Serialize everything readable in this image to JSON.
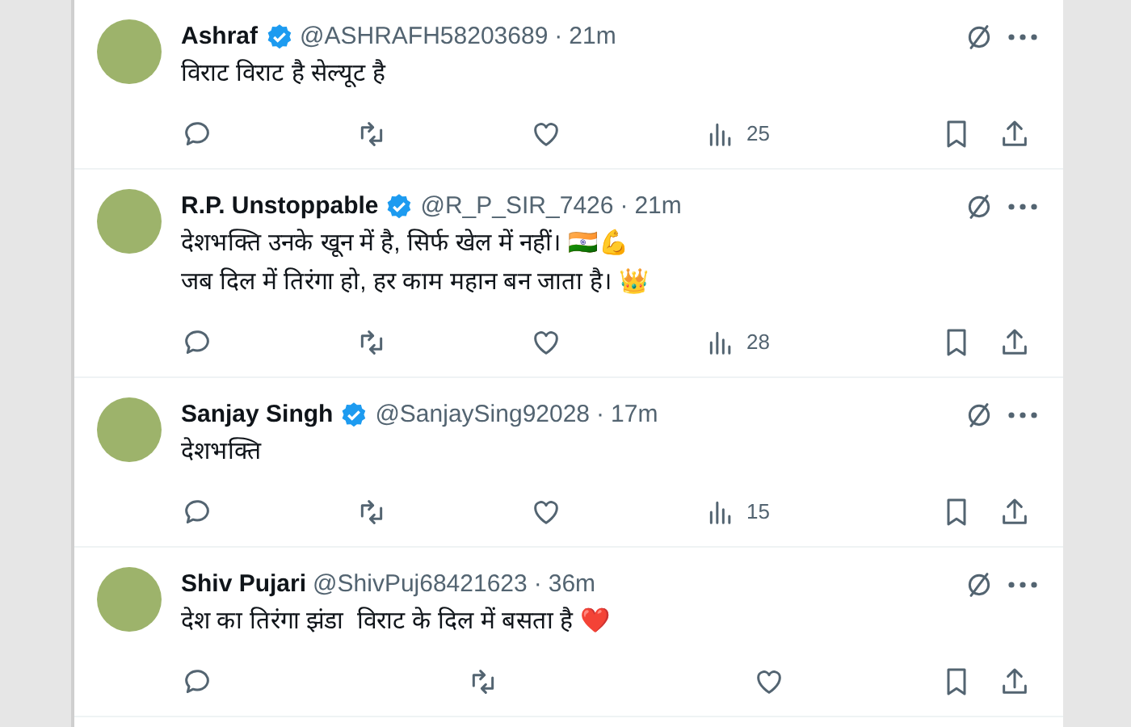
{
  "tweets": [
    {
      "name": "Ashraf",
      "verified": true,
      "handle": "@ASHRAFH58203689",
      "dot": "·",
      "time": "21m",
      "lines": [
        "विराट विराट है सेल्यूट है"
      ],
      "views": "25"
    },
    {
      "name": "R.P. Unstoppable",
      "verified": true,
      "handle": "@R_P_SIR_7426",
      "dot": "·",
      "time": "21m",
      "lines": [
        "देशभक्ति उनके खून में है, सिर्फ खेल में नहीं। 🇮🇳💪",
        "जब दिल में तिरंगा हो, हर काम महान बन जाता है। 👑"
      ],
      "views": "28"
    },
    {
      "name": "Sanjay Singh",
      "verified": true,
      "handle": "@SanjaySing92028",
      "dot": "·",
      "time": "17m",
      "lines": [
        "देशभक्ति"
      ],
      "views": "15"
    },
    {
      "name": "Shiv Pujari",
      "verified": false,
      "handle": "@ShivPuj68421623",
      "dot": "·",
      "time": "36m",
      "lines": [
        "देश का तिरंगा झंडा  विराट के दिल में बसता है ❤️"
      ]
    }
  ]
}
